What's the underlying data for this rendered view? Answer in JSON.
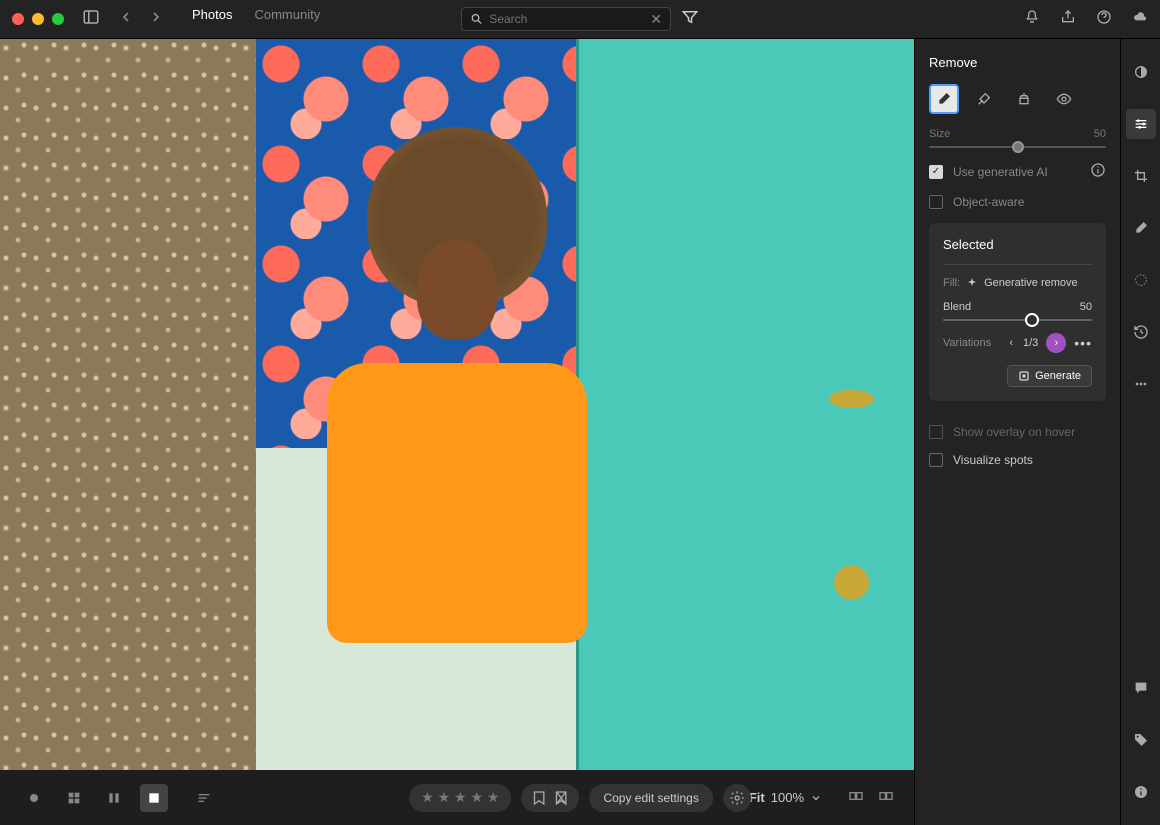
{
  "topbar": {
    "tabs": [
      "Photos",
      "Community"
    ],
    "active_tab": 0,
    "search_placeholder": "Search"
  },
  "panel": {
    "title": "Remove",
    "size_label": "Size",
    "size_value": "50",
    "size_pct": 50,
    "use_ai": {
      "label": "Use generative AI",
      "checked": true
    },
    "object_aware": {
      "label": "Object-aware",
      "checked": false
    },
    "selected": {
      "title": "Selected",
      "fill_label": "Fill:",
      "fill_value": "Generative remove",
      "blend_label": "Blend",
      "blend_value": "50",
      "blend_pct": 60,
      "variations_label": "Variations",
      "variations_count": "1/3",
      "generate_label": "Generate"
    },
    "show_overlay": {
      "label": "Show overlay on hover",
      "checked": false
    },
    "visualize_spots": {
      "label": "Visualize spots",
      "checked": false
    }
  },
  "bottombar": {
    "copy_settings": "Copy edit settings",
    "fit_label": "Fit",
    "zoom_value": "100%"
  }
}
